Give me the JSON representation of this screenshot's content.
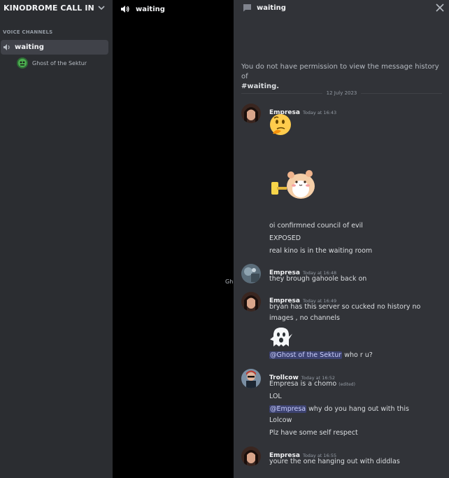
{
  "sidebar": {
    "server_name": "KINODROME CALL IN",
    "category": "VOICE CHANNELS",
    "channel": "waiting",
    "member": "Ghost of the Sektur"
  },
  "voice": {
    "title": "waiting",
    "tile_label": "Gh"
  },
  "chat": {
    "title": "waiting",
    "permission_text": "You do not have permission to view the message history of",
    "permission_channel": "#waiting.",
    "date_divider": "12 July 2023",
    "messages": [
      {
        "author": "Empresa",
        "time": "Today at 16:43",
        "lines": [
          "oi confirmned council of evil",
          "EXPOSED",
          "real kino is in the waiting room"
        ]
      },
      {
        "author": "Empresa",
        "time": "Today at 16:48",
        "lines": [
          "they brough gahoole back on"
        ]
      },
      {
        "author": "Empresa",
        "time": "Today at 16:49",
        "lines": [
          "bryan has this server so cucked no history no",
          "images , no channels"
        ],
        "mention": "@Ghost of the Sektur",
        "after_mention": " who r u?"
      },
      {
        "author": "Trollcow",
        "time": "Today at 16:52",
        "lines": [
          "Empresa is a chomo",
          "LOL",
          "why do you hang out with this",
          "Lolcow",
          "Plz have some self respect"
        ],
        "edited": "(edited)",
        "mention": "@Empresa"
      },
      {
        "author": "Empresa",
        "time": "Today at 16:55",
        "lines": [
          "youre the one hanging out with diddlas"
        ]
      }
    ]
  },
  "colors": {
    "sidebar": "#2b2d31",
    "chat": "#313338",
    "mention_bg": "#3c4270"
  },
  "icons": [
    "chevron-down-icon",
    "speaker-icon",
    "chat-bubble-icon",
    "close-icon",
    "thinking-emoji-icon",
    "hamster-sticker-icon",
    "ghost-emoji-icon"
  ]
}
